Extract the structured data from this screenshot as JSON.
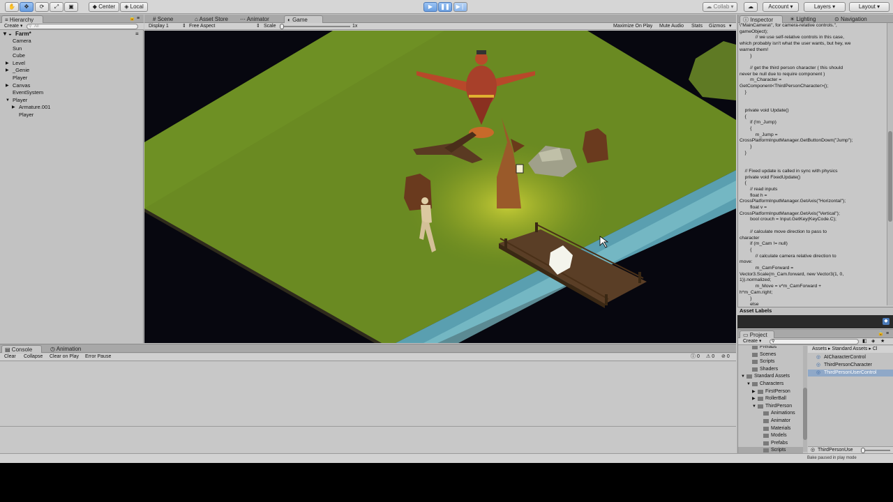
{
  "toolbar": {
    "tools": [
      "hand-tool-icon",
      "move-tool-icon",
      "rotate-tool-icon",
      "scale-tool-icon",
      "rect-tool-icon"
    ],
    "pivot": "Center",
    "space": "Local",
    "collab": "Collab",
    "account": "Account",
    "layers": "Layers",
    "layout": "Layout"
  },
  "hierarchy": {
    "tab": "Hierarchy",
    "create": "Create",
    "search_placeholder": "All",
    "scene": "Farm*",
    "items": [
      {
        "label": "Camera",
        "indent": 1,
        "arrow": ""
      },
      {
        "label": "Sun",
        "indent": 1,
        "arrow": ""
      },
      {
        "label": "Cube",
        "indent": 1,
        "arrow": ""
      },
      {
        "label": "Level",
        "indent": 1,
        "arrow": "▶"
      },
      {
        "label": "_Genie",
        "indent": 1,
        "arrow": "▶"
      },
      {
        "label": "Player",
        "indent": 1,
        "arrow": ""
      },
      {
        "label": "Canvas",
        "indent": 1,
        "arrow": "▶"
      },
      {
        "label": "EventSystem",
        "indent": 1,
        "arrow": ""
      },
      {
        "label": "Player",
        "indent": 1,
        "arrow": "▼"
      },
      {
        "label": "Armature.001",
        "indent": 2,
        "arrow": "▶"
      },
      {
        "label": "Player",
        "indent": 2,
        "arrow": ""
      }
    ]
  },
  "center": {
    "tabs": [
      "Scene",
      "Asset Store",
      "Animator",
      "Game"
    ],
    "active_tab": "Game",
    "display": "Display 1",
    "aspect": "Free Aspect",
    "scale_label": "Scale",
    "scale_value": "1x",
    "options": [
      "Maximize On Play",
      "Mute Audio",
      "Stats",
      "Gizmos"
    ]
  },
  "inspector": {
    "tabs": [
      "Inspector",
      "Lighting",
      "Navigation"
    ],
    "code_lines": [
      "\\\"MainCamera\\\", for camera-relative controls.\",",
      "gameObject);",
      "            // we use self-relative controls in this case,",
      "which probably isn't what the user wants, but hey, we",
      "warned them!",
      "        }",
      "",
      "        // get the third person character ( this should",
      "never be null due to require component )",
      "        m_Character =",
      "GetComponent<ThirdPersonCharacter>();",
      "    }",
      "",
      "",
      "    private void Update()",
      "    {",
      "        if (!m_Jump)",
      "        {",
      "            m_Jump =",
      "CrossPlatformInputManager.GetButtonDown(\"Jump\");",
      "        }",
      "    }",
      "",
      "",
      "    // Fixed update is called in sync with physics",
      "    private void FixedUpdate()",
      "    {",
      "        // read inputs",
      "        float h =",
      "CrossPlatformInputManager.GetAxis(\"Horizontal\");",
      "        float v =",
      "CrossPlatformInputManager.GetAxis(\"Vertical\");",
      "        bool crouch = Input.GetKey(KeyCode.C);",
      "",
      "        // calculate move direction to pass to",
      "character",
      "        if (m_Cam != null)",
      "        {",
      "            // calculate camera relative direction to",
      "move:",
      "            m_CamForward =",
      "Vector3.Scale(m_Cam.forward, new Vector3(1, 0,",
      "1)).normalized;",
      "            m_Move = v*m_CamForward +",
      "h*m_Cam.right;",
      "        }",
      "        else"
    ],
    "asset_labels": "Asset Labels"
  },
  "project": {
    "tab": "Project",
    "create": "Create",
    "breadcrumb": [
      "Assets",
      "Standard Assets",
      "Cl"
    ],
    "tree": [
      {
        "label": "Prefabs",
        "indent": 2,
        "arrow": ""
      },
      {
        "label": "Scenes",
        "indent": 2,
        "arrow": ""
      },
      {
        "label": "Scripts",
        "indent": 2,
        "arrow": ""
      },
      {
        "label": "Shaders",
        "indent": 2,
        "arrow": ""
      },
      {
        "label": "Standard Assets",
        "indent": 1,
        "arrow": "▼"
      },
      {
        "label": "Characters",
        "indent": 2,
        "arrow": "▼"
      },
      {
        "label": "FirstPerson",
        "indent": 3,
        "arrow": "▶"
      },
      {
        "label": "RollerBall",
        "indent": 3,
        "arrow": "▶"
      },
      {
        "label": "ThirdPerson",
        "indent": 3,
        "arrow": "▼"
      },
      {
        "label": "Animations",
        "indent": 4,
        "arrow": ""
      },
      {
        "label": "Animator",
        "indent": 4,
        "arrow": ""
      },
      {
        "label": "Materials",
        "indent": 4,
        "arrow": ""
      },
      {
        "label": "Models",
        "indent": 4,
        "arrow": ""
      },
      {
        "label": "Prefabs",
        "indent": 4,
        "arrow": ""
      },
      {
        "label": "Scripts",
        "indent": 4,
        "arrow": ""
      }
    ],
    "files": [
      "AICharacterControl",
      "ThirdPersonCharacter",
      "ThirdPersonUserControl"
    ],
    "selected_file": "ThirdPersonUserControl",
    "footer_file": "ThirdPersonUse"
  },
  "console": {
    "tabs": [
      "Console",
      "Animation"
    ],
    "buttons": [
      "Clear",
      "Collapse",
      "Clear on Play",
      "Error Pause"
    ],
    "counts": [
      "0",
      "0",
      "0"
    ]
  },
  "status": {
    "text": "Bake paused in play mode"
  }
}
